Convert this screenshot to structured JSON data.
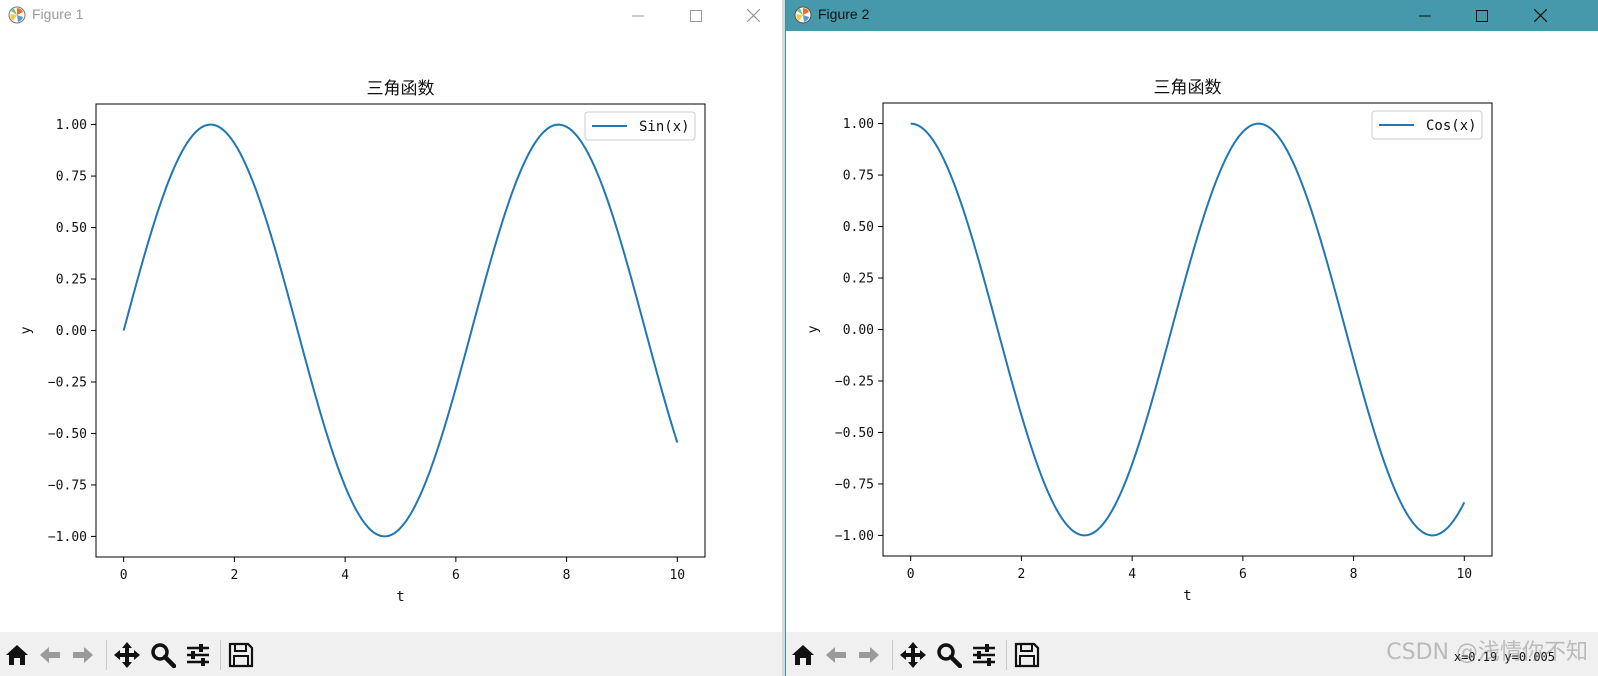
{
  "colors": {
    "line": "#1f77b4",
    "titlebar_active": "#4599ab",
    "toolbar_bg": "#f0f0f0"
  },
  "windows": [
    {
      "title": "Figure 1",
      "coords": "",
      "chart_data": {
        "type": "line",
        "title": "三角函数",
        "xlabel": "t",
        "ylabel": "y",
        "xlim": [
          -0.5,
          10.5
        ],
        "ylim": [
          -1.1,
          1.1
        ],
        "xticks": [
          0,
          2,
          4,
          6,
          8,
          10
        ],
        "xtick_labels": [
          "0",
          "2",
          "4",
          "6",
          "8",
          "10"
        ],
        "yticks": [
          1.0,
          0.75,
          0.5,
          0.25,
          0.0,
          -0.25,
          -0.5,
          -0.75,
          -1.0
        ],
        "ytick_labels": [
          "1.00",
          "0.75",
          "0.50",
          "0.25",
          "0.00",
          "−0.25",
          "−0.50",
          "−0.75",
          "−1.00"
        ],
        "legend_loc": "upper right",
        "series": [
          {
            "name": "Sin(x)",
            "function": "sin",
            "x_range": [
              0,
              10
            ],
            "color": "#1f77b4"
          }
        ]
      }
    },
    {
      "title": "Figure 2",
      "coords": "x=0.19  y=0.005",
      "chart_data": {
        "type": "line",
        "title": "三角函数",
        "xlabel": "t",
        "ylabel": "y",
        "xlim": [
          -0.5,
          10.5
        ],
        "ylim": [
          -1.1,
          1.1
        ],
        "xticks": [
          0,
          2,
          4,
          6,
          8,
          10
        ],
        "xtick_labels": [
          "0",
          "2",
          "4",
          "6",
          "8",
          "10"
        ],
        "yticks": [
          1.0,
          0.75,
          0.5,
          0.25,
          0.0,
          -0.25,
          -0.5,
          -0.75,
          -1.0
        ],
        "ytick_labels": [
          "1.00",
          "0.75",
          "0.50",
          "0.25",
          "0.00",
          "−0.25",
          "−0.50",
          "−0.75",
          "−1.00"
        ],
        "legend_loc": "upper right",
        "series": [
          {
            "name": "Cos(x)",
            "function": "cos",
            "x_range": [
              0,
              10
            ],
            "color": "#1f77b4"
          }
        ]
      }
    }
  ],
  "toolbar_icons": [
    "home-icon",
    "back-icon",
    "forward-icon",
    "pan-icon",
    "zoom-icon",
    "configure-subplots-icon",
    "save-icon"
  ],
  "watermark": "CSDN @浅情你不知"
}
